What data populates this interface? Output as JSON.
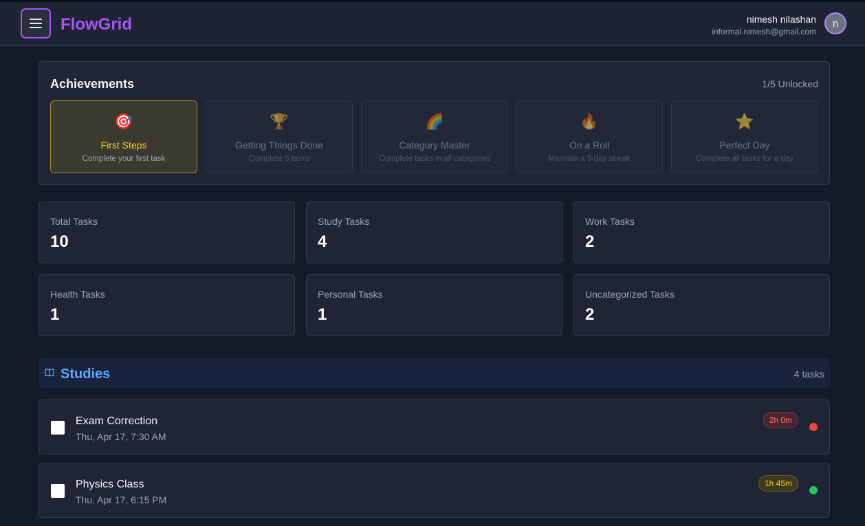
{
  "app": {
    "name": "FlowGrid",
    "accent": "#a855f7"
  },
  "user": {
    "name": "nimesh nilashan",
    "email": "informal.nimesh@gmail.com",
    "avatar_initial": "n"
  },
  "achievements": {
    "title": "Achievements",
    "unlocked_summary": "1/5 Unlocked",
    "items": [
      {
        "icon": "🎯",
        "icon_name": "target-icon",
        "name": "First Steps",
        "description": "Complete your first task",
        "unlocked": true
      },
      {
        "icon": "🏆",
        "icon_name": "trophy-icon",
        "name": "Getting Things Done",
        "description": "Complete 5 tasks",
        "unlocked": false
      },
      {
        "icon": "🌈",
        "icon_name": "rainbow-icon",
        "name": "Category Master",
        "description": "Complete tasks in all categories",
        "unlocked": false
      },
      {
        "icon": "🔥",
        "icon_name": "fire-icon",
        "name": "On a Roll",
        "description": "Maintain a 3-day streak",
        "unlocked": false
      },
      {
        "icon": "⭐",
        "icon_name": "star-icon",
        "name": "Perfect Day",
        "description": "Complete all tasks for a day",
        "unlocked": false
      }
    ]
  },
  "stats": [
    {
      "label": "Total Tasks",
      "value": "10"
    },
    {
      "label": "Study Tasks",
      "value": "4"
    },
    {
      "label": "Work Tasks",
      "value": "2"
    },
    {
      "label": "Health Tasks",
      "value": "1"
    },
    {
      "label": "Personal Tasks",
      "value": "1"
    },
    {
      "label": "Uncategorized Tasks",
      "value": "2"
    }
  ],
  "section": {
    "icon_name": "book-icon",
    "title": "Studies",
    "count": "4 tasks",
    "color": "#60a5fa"
  },
  "tasks": [
    {
      "title": "Exam Correction",
      "time": "Thu, Apr 17, 7:30 AM",
      "duration": "2h 0m",
      "priority_color": "#ef4444",
      "badge_style": "red"
    },
    {
      "title": "Physics Class",
      "time": "Thu, Apr 17, 6:15 PM",
      "duration": "1h 45m",
      "priority_color": "#22c55e",
      "badge_style": "yellow"
    }
  ]
}
